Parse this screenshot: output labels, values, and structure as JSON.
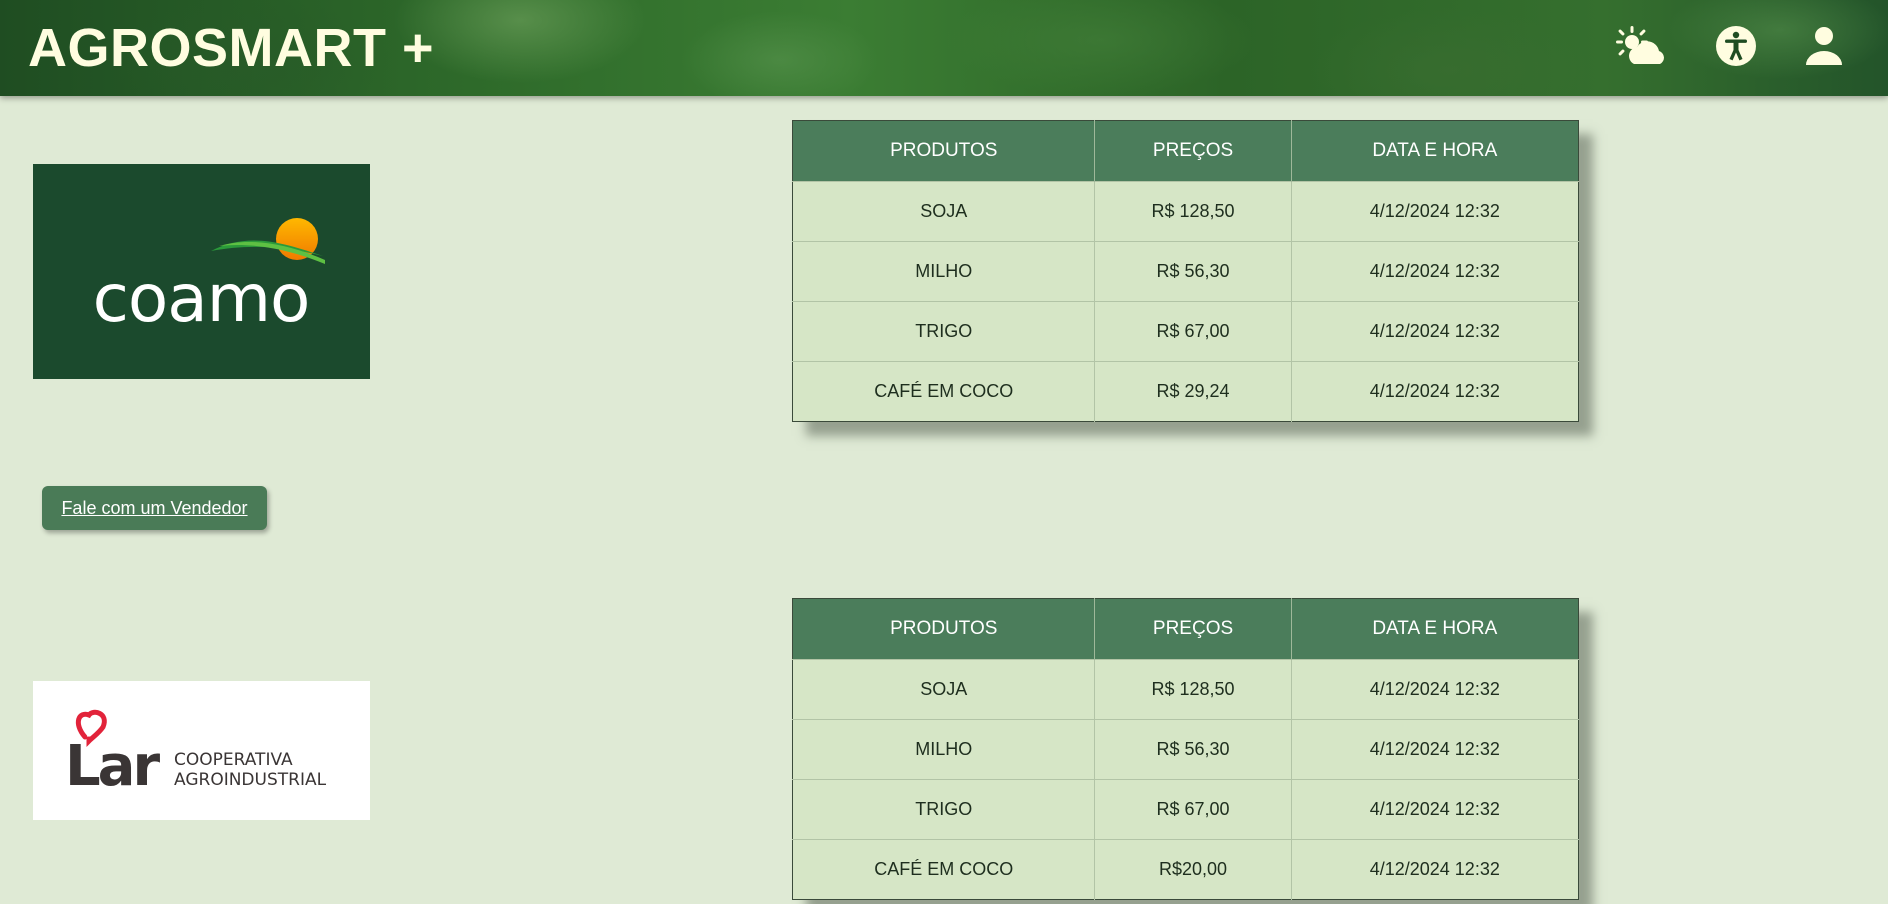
{
  "header": {
    "brand": "AGROSMART +",
    "icons": [
      "weather-icon",
      "accessibility-icon",
      "user-icon"
    ]
  },
  "coamo": {
    "logo_text": "coamo"
  },
  "vendor_button": {
    "label": "Fale com um Vendedor"
  },
  "lar": {
    "logo_word": "Lar",
    "logo_line1": "COOPERATIVA",
    "logo_line2": "AGROINDUSTRIAL"
  },
  "table1": {
    "headers": [
      "PRODUTOS",
      "PREÇOS",
      "DATA E HORA"
    ],
    "rows": [
      [
        "SOJA",
        "R$ 128,50",
        "4/12/2024 12:32"
      ],
      [
        "MILHO",
        "R$ 56,30",
        "4/12/2024 12:32"
      ],
      [
        "TRIGO",
        "R$ 67,00",
        "4/12/2024 12:32"
      ],
      [
        "CAFÉ EM COCO",
        "R$ 29,24",
        "4/12/2024 12:32"
      ]
    ]
  },
  "table2": {
    "headers": [
      "PRODUTOS",
      "PREÇOS",
      "DATA E HORA"
    ],
    "rows": [
      [
        "SOJA",
        "R$ 128,50",
        "4/12/2024 12:32"
      ],
      [
        "MILHO",
        "R$ 56,30",
        "4/12/2024 12:32"
      ],
      [
        "TRIGO",
        "R$ 67,00",
        "4/12/2024 12:32"
      ],
      [
        "CAFÉ EM COCO",
        "R$20,00",
        "4/12/2024 12:32"
      ]
    ]
  },
  "colors": {
    "background": "#dfead5",
    "table_header": "#4b7d5b",
    "table_body": "#d6e6c6",
    "button": "#4a7b57",
    "coamo_bg": "#1b4a2d",
    "brand_text": "#fffde0"
  }
}
